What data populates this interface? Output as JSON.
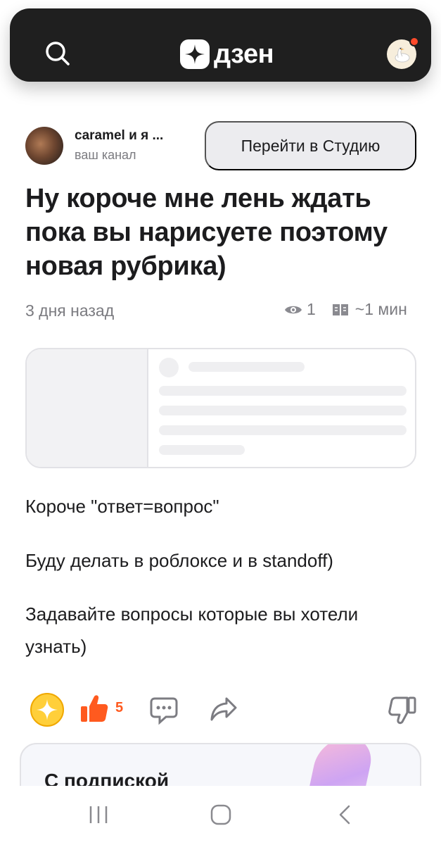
{
  "header": {
    "logo_text": "дзен",
    "icons": [
      "search-icon",
      "zen-star-icon",
      "goose-avatar-icon"
    ],
    "notification_dot_color": "#ff4a2a"
  },
  "channel": {
    "name": "caramel и я ...",
    "subtitle": "ваш канал",
    "studio_button": "Перейти в Студию"
  },
  "article": {
    "title": "Ну короче мне лень ждать пока вы нарисуете поэтому новая рубрика)",
    "time": "3 дня назад",
    "views": "1",
    "read_time": "~1 мин",
    "paragraphs": [
      "Короче \"ответ=вопрос\"",
      "Буду делать в роблоксе и в standoff)",
      "Задавайте вопросы которые вы хотели узнать)"
    ]
  },
  "actions": {
    "likes_count": "5",
    "accent_color": "#ff5a1f",
    "icons": [
      "zen-sparkle-icon",
      "thumbs-up-icon",
      "comment-icon",
      "share-icon",
      "thumbs-down-icon"
    ]
  },
  "promo": {
    "text": "С подпиской"
  },
  "system_nav": {
    "icons": [
      "recent-apps-icon",
      "home-icon",
      "back-icon"
    ]
  }
}
